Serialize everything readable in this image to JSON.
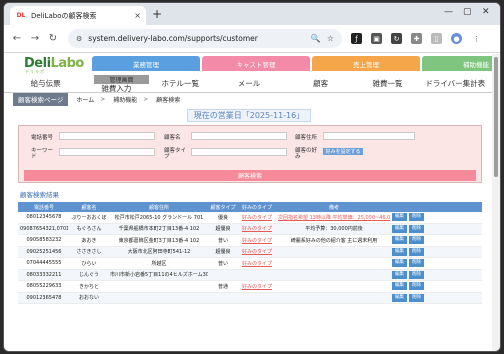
{
  "browser": {
    "tab_favicon": "DL",
    "tab_title": "DeliLaboの顧客検索",
    "tab_close": "×",
    "newtab": "+",
    "url": "system.delivery-labo.com/supports/customer",
    "window_controls": [
      "—",
      "▢",
      "✕"
    ]
  },
  "app": {
    "logo_main": "Deli",
    "logo_accent": "Labo",
    "logo_sub": "デリラボ",
    "top_menu": [
      {
        "label": "業務管理",
        "color": "#5aa0e0"
      },
      {
        "label": "キャスト管理",
        "color": "#f28aa8"
      },
      {
        "label": "売上管理",
        "color": "#f5a64a"
      },
      {
        "label": "補助機能",
        "color": "#7fc47f"
      }
    ],
    "sub_nav": [
      "給与伝票",
      "雑費入力",
      "ホテル一覧",
      "メール",
      "顧客",
      "雑費一覧",
      "ドライバー集計表"
    ],
    "float_panel": "管理画面",
    "breadcrumb": {
      "active": "顧客検索ページ",
      "items": [
        "ホーム",
        "補助機能",
        "顧客検索"
      ]
    },
    "sales_today": "現在の営業日「2025-11-16」",
    "search": {
      "tel_label": "電話番号",
      "name_label": "顧客名",
      "address_label": "顧客住所",
      "keyword_label": "キーワード",
      "type_label": "顧客タイプ",
      "favorite_label": "顧客の好み",
      "favorite_btn": "好みを設定する",
      "submit": "顧客検索"
    },
    "results_title": "顧客検索結果",
    "columns": [
      "電話番号",
      "顧客名",
      "顧客住所",
      "顧客タイプ",
      "好みのタイプ",
      "備考",
      ""
    ],
    "rows": [
      {
        "tel": "08012345678",
        "name": "ぷりーおおくぼ",
        "addr": "松戸市松戸2065-10 グランドール 701",
        "type": "優良",
        "fav": "好みのタイプ",
        "note": "次回指名希望 13時以降 平均単価：25,000~46,000",
        "note_link": true
      },
      {
        "tel": "09087654321,07013142545",
        "name": "もぐろさん",
        "addr": "千葉県船橋市本町2丁目13番-4 102",
        "type": "超優良",
        "fav": "好みのタイプ",
        "note": "平均予算：30,000円前後",
        "note_link": false
      },
      {
        "tel": "09058583232",
        "name": "あおき",
        "addr": "東京都葛飾区金町3丁目13番-4 102",
        "type": "普い",
        "fav": "好みのタイプ",
        "note": "綺麗系好みの他の紹介客 主に週末利用",
        "note_link": false
      },
      {
        "tel": "09025251456",
        "name": "ささきさし",
        "addr": "大阪市北区阿田寺町541-12",
        "type": "超優良",
        "fav": "好みのタイプ",
        "note": "",
        "note_link": false
      },
      {
        "tel": "07044445555",
        "name": "ひらい",
        "addr": "所越区",
        "type": "普い",
        "fav": "好みのタイプ",
        "note": "",
        "note_link": false
      },
      {
        "tel": "08033332211",
        "name": "じんぐう",
        "addr": "市川市新小岩番5丁目11の4ヒルズホーム303",
        "type": "",
        "fav": "",
        "note": "",
        "note_link": false
      },
      {
        "tel": "08055229633",
        "name": "きかちと",
        "addr": "",
        "type": "普通",
        "fav": "好みのタイプ",
        "note": "",
        "note_link": false
      },
      {
        "tel": "09012365478",
        "name": "おおない",
        "addr": "",
        "type": "",
        "fav": "",
        "note": "",
        "note_link": false
      }
    ],
    "row_btn_edit": "編集",
    "row_btn_delete": "削除"
  },
  "colors": {
    "accent_blue": "#5f93cf",
    "search_bg": "#fbe5e5",
    "search_btn": "#f48a9a"
  }
}
